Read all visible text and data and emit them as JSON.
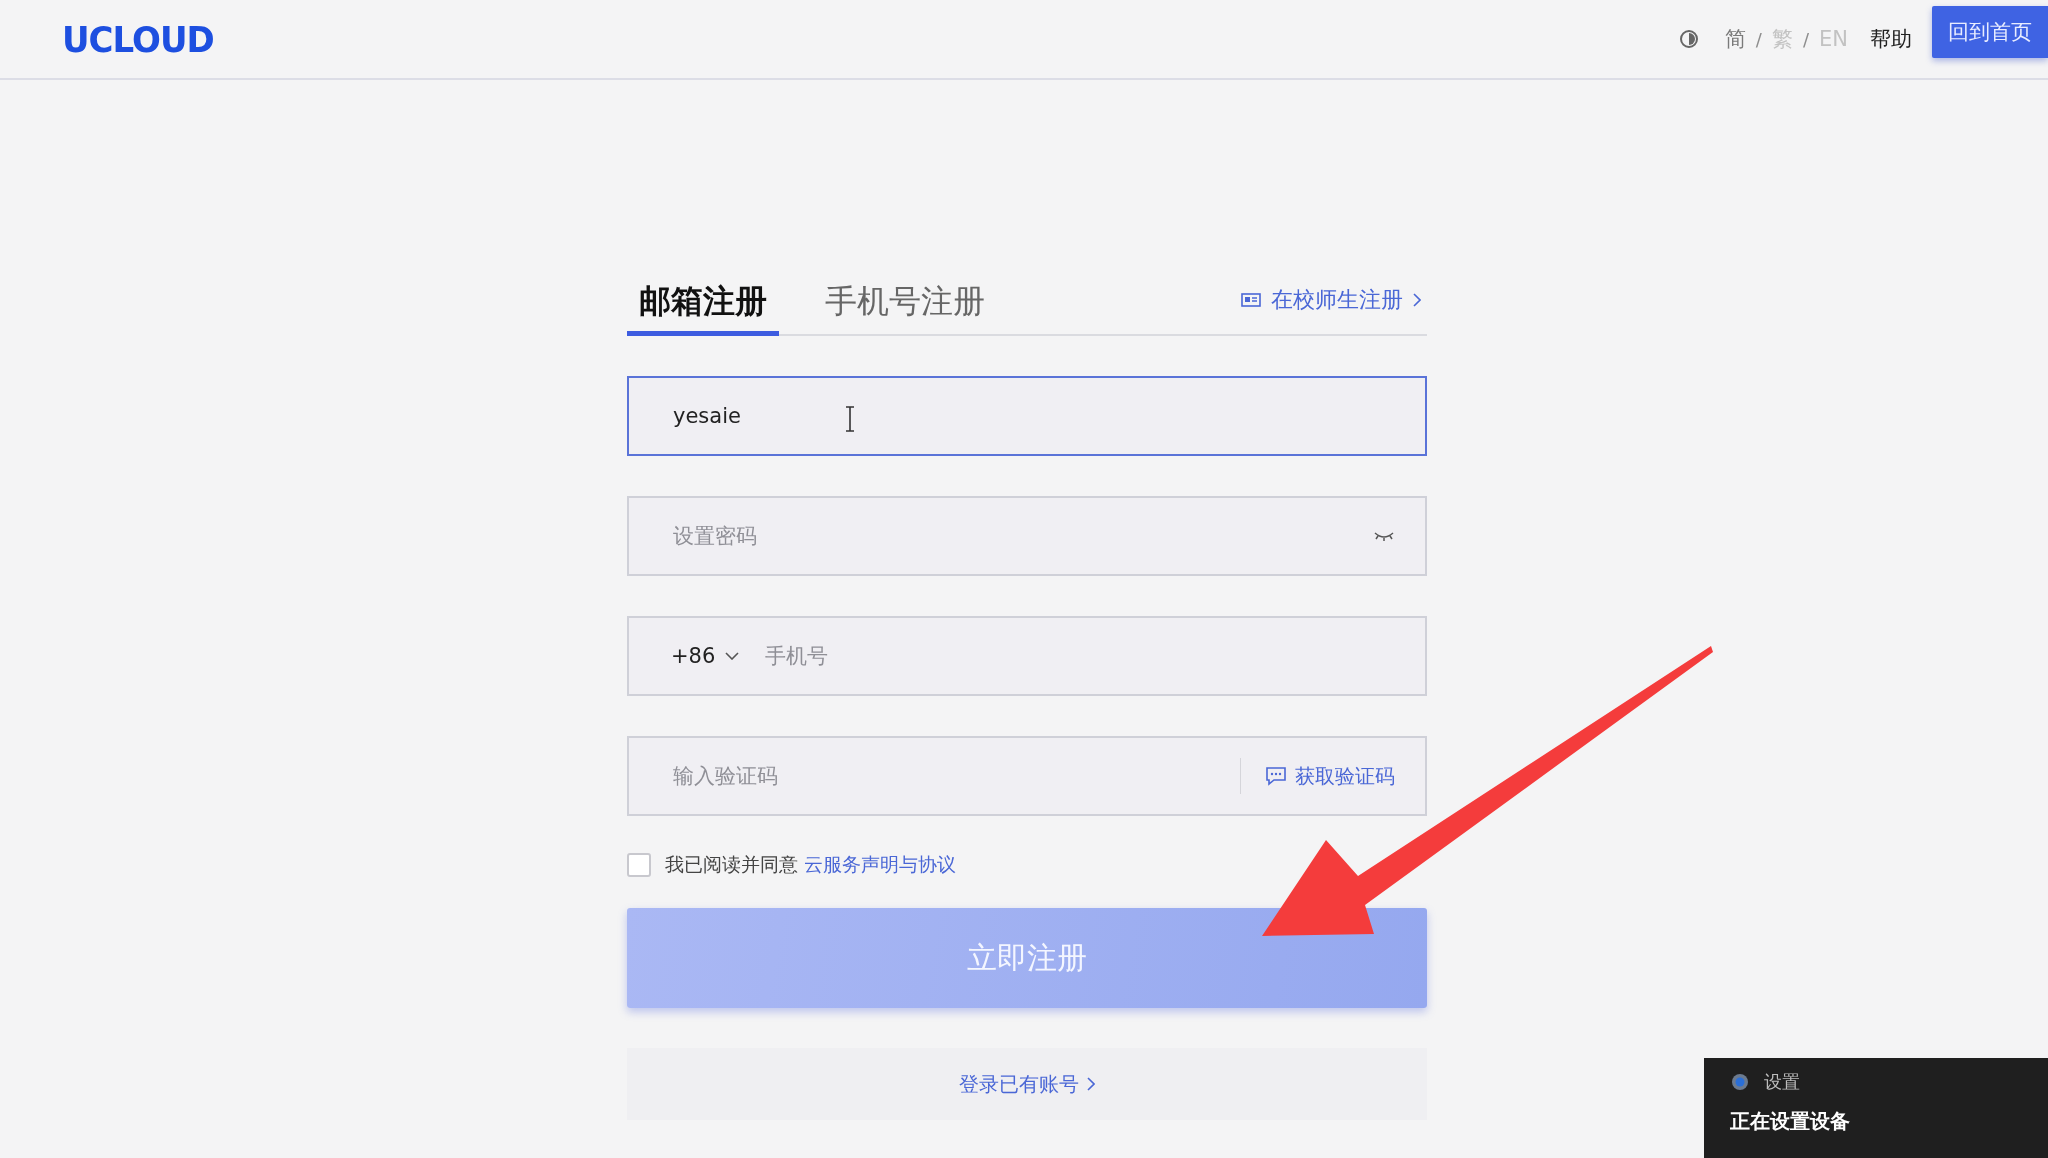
{
  "header": {
    "logo": "UCLOUD",
    "separator": "/",
    "languages": [
      {
        "label": "简",
        "selected": true
      },
      {
        "label": "繁",
        "selected": false
      },
      {
        "label": "EN",
        "selected": false
      }
    ],
    "help": "帮助",
    "home_button": "回到首页"
  },
  "tabs": [
    {
      "label": "邮箱注册",
      "selected": true
    },
    {
      "label": "手机号注册",
      "selected": false
    }
  ],
  "campus_link": "在校师生注册",
  "fields": [
    {
      "kind": "text",
      "value": "yesaie"
    },
    {
      "kind": "password",
      "placeholder": "设置密码"
    },
    {
      "kind": "phone",
      "country_code": "+86",
      "placeholder": "手机号"
    },
    {
      "kind": "code",
      "placeholder": "输入验证码",
      "action": "获取验证码"
    }
  ],
  "agreement": {
    "checked": false,
    "text": "我已阅读并同意",
    "link": "云服务声明与协议"
  },
  "submit_button": {
    "label": "立即注册",
    "disabled": true
  },
  "login_link": "登录已有账号",
  "notification": {
    "app": "设置",
    "message": "正在设置设备"
  }
}
